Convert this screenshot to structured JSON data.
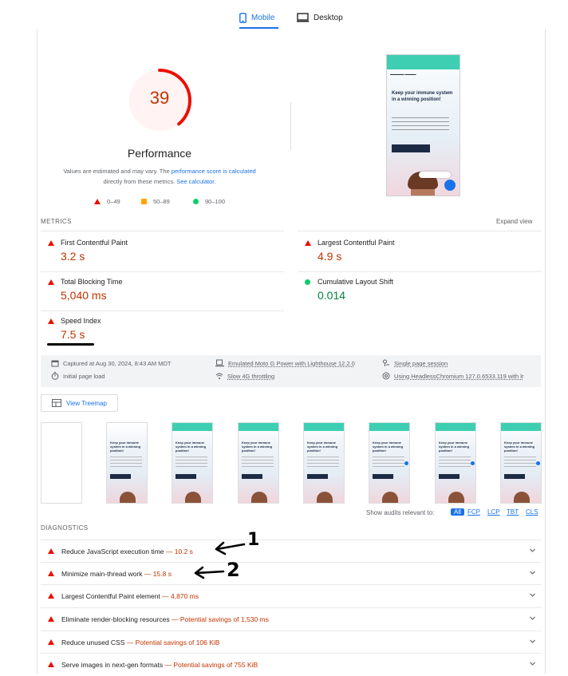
{
  "tabs": [
    {
      "label": "Mobile",
      "active": true
    },
    {
      "label": "Desktop",
      "active": false
    }
  ],
  "score": {
    "value": "39",
    "fraction": 0.39,
    "label": "Performance"
  },
  "note": {
    "line1_pre": "Values are estimated and may vary. The ",
    "line1_link": "performance score is calculated",
    "line2_pre": "directly from these metrics. ",
    "line2_link": "See calculator."
  },
  "legend": [
    {
      "range": "0–49",
      "kind": "fail"
    },
    {
      "range": "50–89",
      "kind": "average"
    },
    {
      "range": "90–100",
      "kind": "pass"
    }
  ],
  "metrics": {
    "title": "METRICS",
    "expand": "Expand view",
    "items": [
      {
        "label": "First Contentful Paint",
        "value": "3.2 s",
        "status": "fail"
      },
      {
        "label": "Largest Contentful Paint",
        "value": "4.9 s",
        "status": "fail"
      },
      {
        "label": "Total Blocking Time",
        "value": "5,040 ms",
        "status": "fail"
      },
      {
        "label": "Cumulative Layout Shift",
        "value": "0.014",
        "status": "pass"
      },
      {
        "label": "Speed Index",
        "value": "7.5 s",
        "status": "fail"
      }
    ]
  },
  "info": {
    "captured": "Captured at Aug 30, 2024, 8:43 AM MDT",
    "device": "Emulated Moto G Power with Lighthouse 12.2.0",
    "session": "Single page session",
    "load": "Initial page load",
    "throttling": "Slow 4G throttling",
    "browser": "Using HeadlessChromium 127.0.6533.119 with lr"
  },
  "treemap": {
    "label": "View Treemap"
  },
  "preview": {
    "hero": "Keep your immune system in a winning position!",
    "thumb_hero": "Keep your immune system in a winning position!"
  },
  "filter": {
    "label": "Show audits relevant to:",
    "chips": [
      "All",
      "FCP",
      "LCP",
      "TBT",
      "CLS"
    ]
  },
  "diagnostics": {
    "title": "DIAGNOSTICS",
    "items": [
      {
        "label": "Reduce JavaScript execution time",
        "value": "10.2 s"
      },
      {
        "label": "Minimize main-thread work",
        "value": "15.8 s"
      },
      {
        "label": "Largest Contentful Paint element",
        "value": "4,870 ms"
      },
      {
        "label": "Eliminate render-blocking resources",
        "value": "Potential savings of 1,530 ms"
      },
      {
        "label": "Reduce unused CSS",
        "value": "Potential savings of 106 KiB"
      },
      {
        "label": "Serve images in next-gen formats",
        "value": "Potential savings of 755 KiB"
      }
    ]
  },
  "annotations": [
    "1",
    "2"
  ],
  "colors": {
    "fail": "#eb0f00",
    "fail_text": "#c33300",
    "average": "#ffa400",
    "pass": "#0cce6b",
    "pass_text": "#018642",
    "link": "#1a73e8"
  }
}
